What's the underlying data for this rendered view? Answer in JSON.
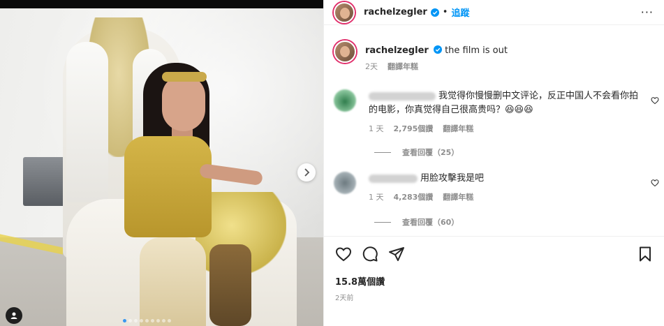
{
  "post": {
    "media": {
      "carousel_dots": 9,
      "active_dot": 0
    },
    "header": {
      "username": "rachelzegler",
      "separator": "•",
      "follow_label": "追蹤",
      "more_label": "···"
    },
    "caption": {
      "username": "rachelzegler",
      "text": "the film is out",
      "time": "2天",
      "translate": "翻譯年糕"
    },
    "comments": [
      {
        "text": "我觉得你慢慢删中文评论，反正中国人不会看你拍的电影，你真觉得自己很高贵吗？😆😆😆",
        "time": "1 天",
        "likes": "2,795個讚",
        "translate": "翻譯年糕",
        "replies": "查看回覆（25）"
      },
      {
        "text": "用脸攻擊我是吧",
        "time": "1 天",
        "likes": "4,283個讚",
        "translate": "翻譯年糕",
        "replies": "查看回覆（60）"
      }
    ],
    "likes_count": "15.8萬個讚",
    "post_date": "2天前"
  },
  "colors": {
    "accent": "#0095f6",
    "muted": "#8e8e8e",
    "text": "#262626",
    "story_ring": "#e1306c"
  },
  "icons": [
    "verified-badge-icon",
    "heart-icon",
    "comment-icon",
    "share-icon",
    "bookmark-icon",
    "chevron-right-icon",
    "user-tag-icon",
    "more-options-icon"
  ]
}
